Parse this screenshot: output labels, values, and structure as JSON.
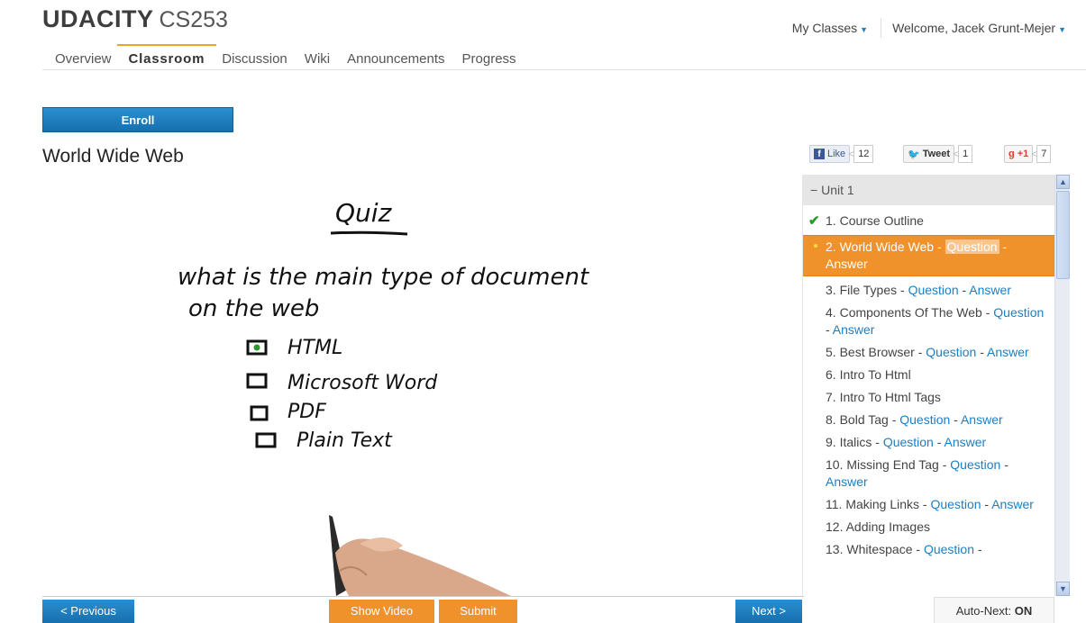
{
  "header": {
    "logo": "UDACITY",
    "course": "CS253",
    "my_classes": "My Classes",
    "welcome": "Welcome, Jacek Grunt-Mejer"
  },
  "nav": {
    "tabs": [
      "Overview",
      "Classroom",
      "Discussion",
      "Wiki",
      "Announcements",
      "Progress"
    ],
    "active": "Classroom"
  },
  "enroll_label": "Enroll",
  "page_title": "World Wide Web",
  "social": {
    "fb_label": "Like",
    "fb_count": "12",
    "tweet_label": "Tweet",
    "tweet_count": "1",
    "gplus_label": "+1",
    "gplus_count": "7"
  },
  "video": {
    "heading": "Quiz",
    "question_line1": "what is the main type of document",
    "question_line2": "on the web",
    "options": [
      "HTML",
      "Microsoft Word",
      "PDF",
      "Plain Text"
    ],
    "checked_option": "HTML"
  },
  "sidebar": {
    "unit": "Unit 1",
    "collapse_symbol": "−",
    "lessons": [
      {
        "num": "1.",
        "title": "Course Outline",
        "question": "",
        "answer": "",
        "done": true
      },
      {
        "num": "2.",
        "title": "World Wide Web -",
        "question": "Question",
        "answer": "Answer",
        "current": true
      },
      {
        "num": "3.",
        "title": "File Types -",
        "question": "Question",
        "answer": "Answer"
      },
      {
        "num": "4.",
        "title": "Components Of The Web -",
        "question": "Question",
        "answer": "Answer"
      },
      {
        "num": "5.",
        "title": "Best Browser -",
        "question": "Question",
        "answer": "Answer"
      },
      {
        "num": "6.",
        "title": "Intro To Html",
        "question": "",
        "answer": ""
      },
      {
        "num": "7.",
        "title": "Intro To Html Tags",
        "question": "",
        "answer": ""
      },
      {
        "num": "8.",
        "title": "Bold Tag -",
        "question": "Question",
        "answer": "Answer"
      },
      {
        "num": "9.",
        "title": "Italics -",
        "question": "Question",
        "answer": "Answer"
      },
      {
        "num": "10.",
        "title": "Missing End Tag -",
        "question": "Question",
        "answer": "Answer"
      },
      {
        "num": "11.",
        "title": "Making Links -",
        "question": "Question",
        "answer": "Answer"
      },
      {
        "num": "12.",
        "title": "Adding Images",
        "question": "",
        "answer": ""
      },
      {
        "num": "13.",
        "title": "Whitespace -",
        "question": "Question",
        "answer": ""
      }
    ]
  },
  "controls": {
    "previous": "< Previous",
    "show_video": "Show Video",
    "submit": "Submit",
    "next": "Next >",
    "autonext_label": "Auto-Next:",
    "autonext_state": "ON"
  },
  "colors": {
    "accent_blue": "#1b7fc4",
    "accent_orange": "#f0922c"
  }
}
